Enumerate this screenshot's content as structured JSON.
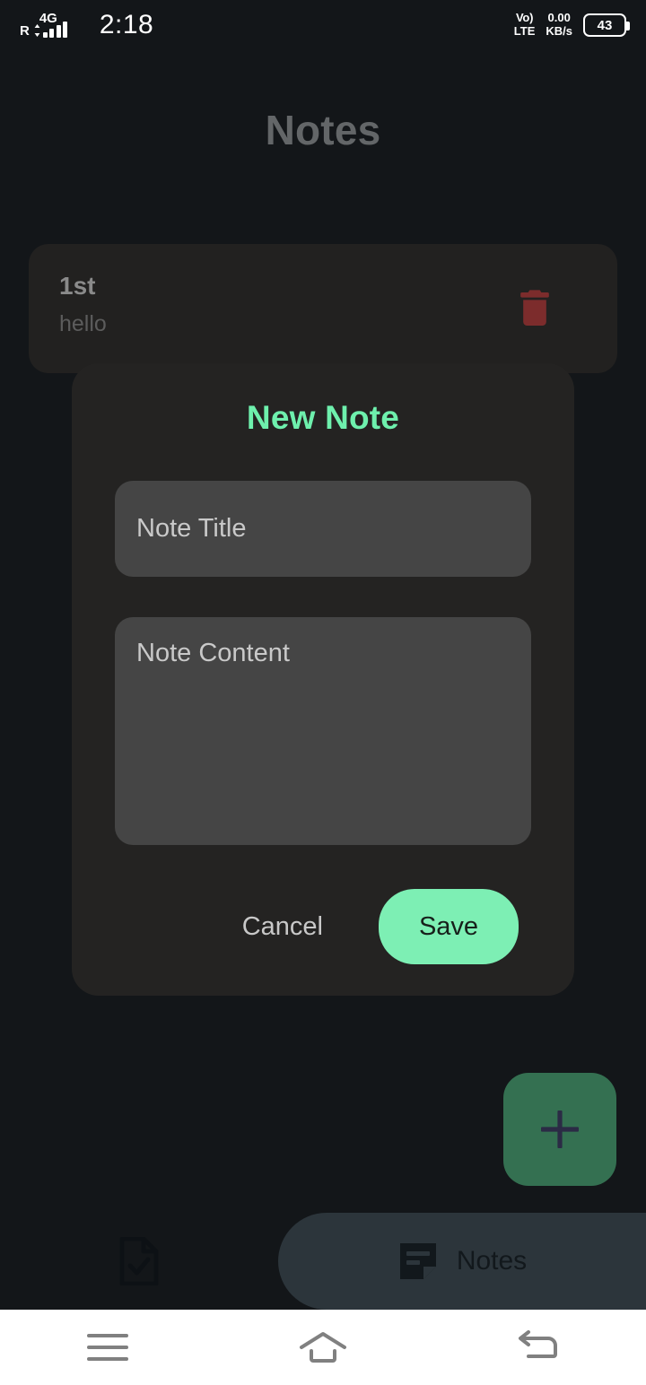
{
  "status_bar": {
    "roaming": "R",
    "network_type": "4G",
    "time": "2:18",
    "volte_line1": "Vo)",
    "volte_line2": "LTE",
    "data_rate_value": "0.00",
    "data_rate_unit": "KB/s",
    "battery_percent": "43"
  },
  "app": {
    "title": "Notes",
    "title_color": "#636668",
    "accent_color": "#7defb4",
    "background_color": "#131619"
  },
  "notes": [
    {
      "title": "1st",
      "content": "hello",
      "delete_icon": "trash-icon",
      "delete_icon_color": "#7c2c2c"
    }
  ],
  "dialog": {
    "title": "New Note",
    "title_color": "#6ef0ad",
    "surface_color": "#242322",
    "title_field": {
      "placeholder": "Note Title",
      "value": "",
      "background_color": "#454545"
    },
    "content_field": {
      "placeholder": "Note Content",
      "value": "",
      "background_color": "#454545"
    },
    "cancel_label": "Cancel",
    "save_label": "Save",
    "save_background_color": "#7defb4"
  },
  "fab": {
    "icon": "plus-icon",
    "background_color": "#347051",
    "icon_color": "#2b2b45"
  },
  "bottom_nav": {
    "items": [
      {
        "icon": "document-check-icon",
        "label": "",
        "selected": false
      },
      {
        "icon": "note-icon",
        "label": "Notes",
        "selected": true
      }
    ],
    "selected_background_color": "#2c353b"
  },
  "system_nav": {
    "recents_icon": "hamburger-icon",
    "home_icon": "home-icon",
    "back_icon": "back-arrow-icon",
    "background_color": "#ffffff",
    "icon_color": "#808080"
  }
}
